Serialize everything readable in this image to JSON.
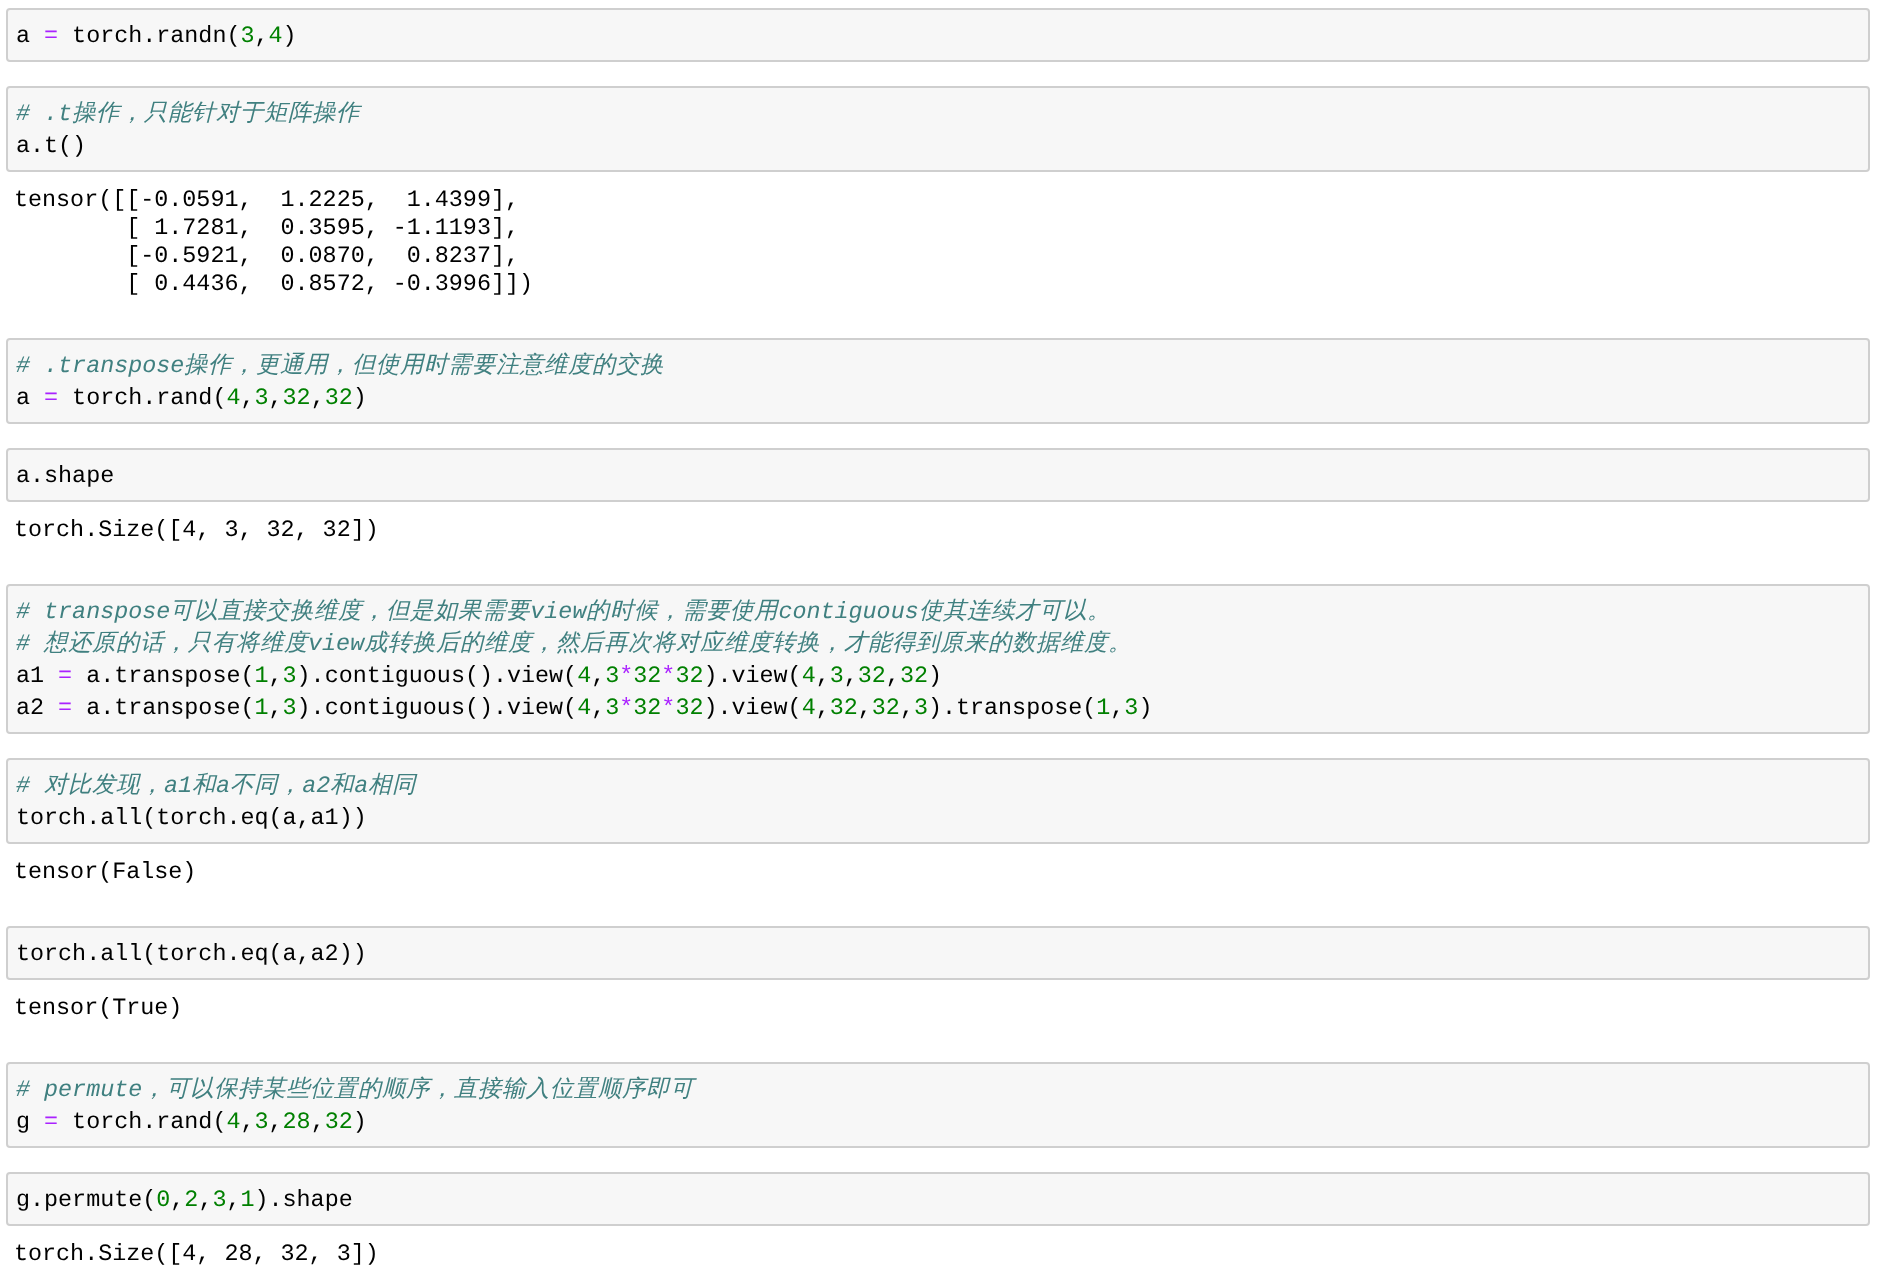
{
  "cells": [
    {
      "input": [
        {
          "kind": "code",
          "text": "a = torch.randn(3,4)"
        }
      ]
    },
    {
      "input": [
        {
          "kind": "comment",
          "text": "# .t操作，只能针对于矩阵操作"
        },
        {
          "kind": "code",
          "text": "a.t()"
        }
      ],
      "output": [
        "tensor([[-0.0591,  1.2225,  1.4399],",
        "        [ 1.7281,  0.3595, -1.1193],",
        "        [-0.5921,  0.0870,  0.8237],",
        "        [ 0.4436,  0.8572, -0.3996]])"
      ]
    },
    {
      "input": [
        {
          "kind": "comment",
          "text": "# .transpose操作，更通用，但使用时需要注意维度的交换"
        },
        {
          "kind": "code",
          "text": "a = torch.rand(4,3,32,32)"
        }
      ]
    },
    {
      "input": [
        {
          "kind": "code",
          "text": "a.shape"
        }
      ],
      "output": [
        "torch.Size([4, 3, 32, 32])"
      ]
    },
    {
      "input": [
        {
          "kind": "comment",
          "text": "# transpose可以直接交换维度，但是如果需要view的时候，需要使用contiguous使其连续才可以。"
        },
        {
          "kind": "comment",
          "text": "# 想还原的话，只有将维度view成转换后的维度，然后再次将对应维度转换，才能得到原来的数据维度。"
        },
        {
          "kind": "code",
          "text": "a1 = a.transpose(1,3).contiguous().view(4,3*32*32).view(4,3,32,32)"
        },
        {
          "kind": "code",
          "text": "a2 = a.transpose(1,3).contiguous().view(4,3*32*32).view(4,32,32,3).transpose(1,3)"
        }
      ]
    },
    {
      "input": [
        {
          "kind": "comment",
          "text": "# 对比发现，a1和a不同，a2和a相同"
        },
        {
          "kind": "code",
          "text": "torch.all(torch.eq(a,a1))"
        }
      ],
      "output": [
        "tensor(False)"
      ]
    },
    {
      "input": [
        {
          "kind": "code",
          "text": "torch.all(torch.eq(a,a2))"
        }
      ],
      "output": [
        "tensor(True)"
      ]
    },
    {
      "input": [
        {
          "kind": "comment",
          "text": "# permute，可以保持某些位置的顺序，直接输入位置顺序即可"
        },
        {
          "kind": "code",
          "text": "g = torch.rand(4,3,28,32)"
        }
      ]
    },
    {
      "input": [
        {
          "kind": "code",
          "text": "g.permute(0,2,3,1).shape"
        }
      ],
      "output": [
        "torch.Size([4, 28, 32, 3])"
      ]
    }
  ]
}
